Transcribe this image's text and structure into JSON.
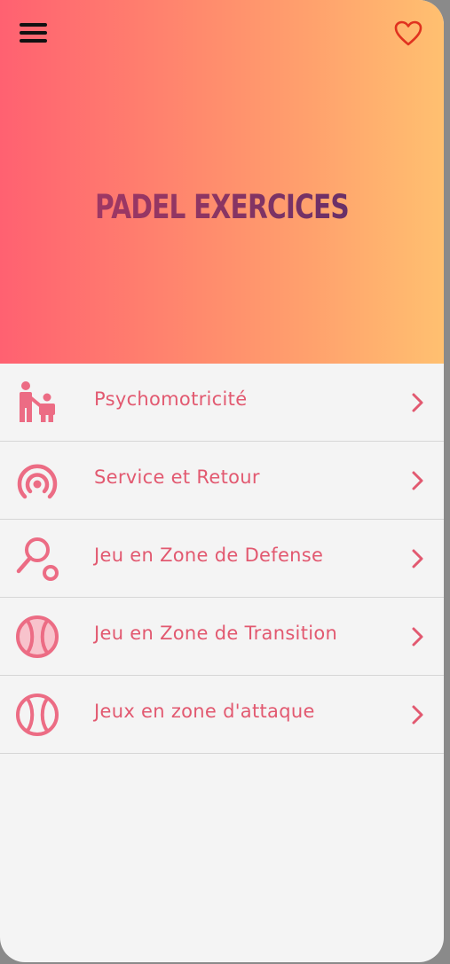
{
  "app": {
    "title": "PADEL EXERCICES"
  },
  "header": {
    "menu_icon": "hamburger-menu-icon",
    "favorite_icon": "heart-outline-icon",
    "gradient_start": "#ff6171",
    "gradient_end": "#ffc070",
    "title_color": "#7a3363"
  },
  "list": {
    "accent_color": "#e25970",
    "items": [
      {
        "label": "Psychomotricité",
        "icon": "parent-child-icon"
      },
      {
        "label": "Service et Retour",
        "icon": "signal-target-icon"
      },
      {
        "label": "Jeu en Zone de Defense",
        "icon": "racket-ball-icon"
      },
      {
        "label": "Jeu en Zone de Transition",
        "icon": "tennis-ball-filled-icon"
      },
      {
        "label": "Jeux en zone d'attaque",
        "icon": "tennis-ball-outline-icon"
      }
    ]
  }
}
